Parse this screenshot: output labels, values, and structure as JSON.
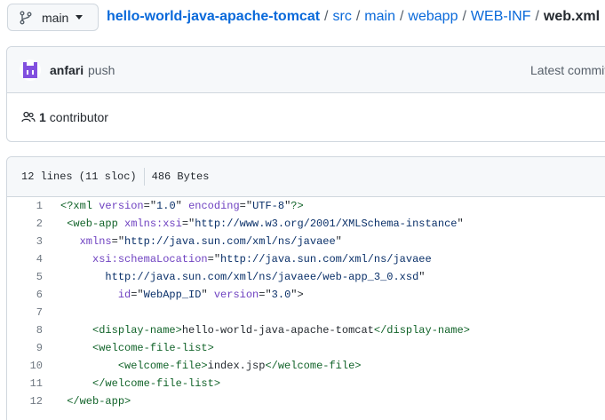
{
  "branch": {
    "label": "main",
    "icon": "git-branch-icon"
  },
  "breadcrumb": {
    "repo": "hello-world-java-apache-tomcat",
    "separator": "/",
    "segments": [
      "src",
      "main",
      "webapp",
      "WEB-INF"
    ],
    "current": "web.xml"
  },
  "commit": {
    "author": "anfari",
    "message": "push",
    "latest_label": "Latest commit",
    "contributors_count": "1",
    "contributors_label": "contributor"
  },
  "file": {
    "lines_info": "12 lines (11 sloc)",
    "size": "486 Bytes",
    "code": [
      {
        "n": "1",
        "indent": "",
        "parts": [
          [
            "t",
            "<?xml"
          ],
          [
            "p",
            " "
          ],
          [
            "a",
            "version"
          ],
          [
            "p",
            "=\""
          ],
          [
            "s",
            "1.0"
          ],
          [
            "p",
            "\" "
          ],
          [
            "a",
            "encoding"
          ],
          [
            "p",
            "=\""
          ],
          [
            "s",
            "UTF-8"
          ],
          [
            "p",
            "\""
          ],
          [
            "t",
            "?>"
          ]
        ]
      },
      {
        "n": "2",
        "indent": " ",
        "parts": [
          [
            "t",
            "<web-app"
          ],
          [
            "p",
            " "
          ],
          [
            "a",
            "xmlns:xsi"
          ],
          [
            "p",
            "=\""
          ],
          [
            "s",
            "http://www.w3.org/2001/XMLSchema-instance"
          ],
          [
            "p",
            "\""
          ]
        ]
      },
      {
        "n": "3",
        "indent": "   ",
        "parts": [
          [
            "a",
            "xmlns"
          ],
          [
            "p",
            "=\""
          ],
          [
            "s",
            "http://java.sun.com/xml/ns/javaee"
          ],
          [
            "p",
            "\""
          ]
        ]
      },
      {
        "n": "4",
        "indent": "     ",
        "parts": [
          [
            "a",
            "xsi:schemaLocation"
          ],
          [
            "p",
            "=\""
          ],
          [
            "s",
            "http://java.sun.com/xml/ns/javaee"
          ]
        ]
      },
      {
        "n": "5",
        "indent": "       ",
        "parts": [
          [
            "s",
            "http://java.sun.com/xml/ns/javaee/web-app_3_0.xsd"
          ],
          [
            "p",
            "\""
          ]
        ]
      },
      {
        "n": "6",
        "indent": "         ",
        "parts": [
          [
            "a",
            "id"
          ],
          [
            "p",
            "=\""
          ],
          [
            "s",
            "WebApp_ID"
          ],
          [
            "p",
            "\" "
          ],
          [
            "a",
            "version"
          ],
          [
            "p",
            "=\""
          ],
          [
            "s",
            "3.0"
          ],
          [
            "p",
            "\">"
          ]
        ]
      },
      {
        "n": "7",
        "indent": "",
        "parts": []
      },
      {
        "n": "8",
        "indent": "     ",
        "parts": [
          [
            "t",
            "<display-name>"
          ],
          [
            "p",
            "hello-world-java-apache-tomcat"
          ],
          [
            "t",
            "</display-name>"
          ]
        ]
      },
      {
        "n": "9",
        "indent": "     ",
        "parts": [
          [
            "t",
            "<welcome-file-list>"
          ]
        ]
      },
      {
        "n": "10",
        "indent": "         ",
        "parts": [
          [
            "t",
            "<welcome-file>"
          ],
          [
            "p",
            "index.jsp"
          ],
          [
            "t",
            "</welcome-file>"
          ]
        ]
      },
      {
        "n": "11",
        "indent": "     ",
        "parts": [
          [
            "t",
            "</welcome-file-list>"
          ]
        ]
      },
      {
        "n": "12",
        "indent": " ",
        "parts": [
          [
            "t",
            "</web-app>"
          ]
        ]
      }
    ]
  },
  "colors": {
    "link": "#0969da",
    "border": "#d0d7de",
    "header_bg": "#f6f8fa",
    "tag": "#116329",
    "attr": "#6f42c1",
    "string": "#0a3069",
    "avatar": "#8250df"
  }
}
